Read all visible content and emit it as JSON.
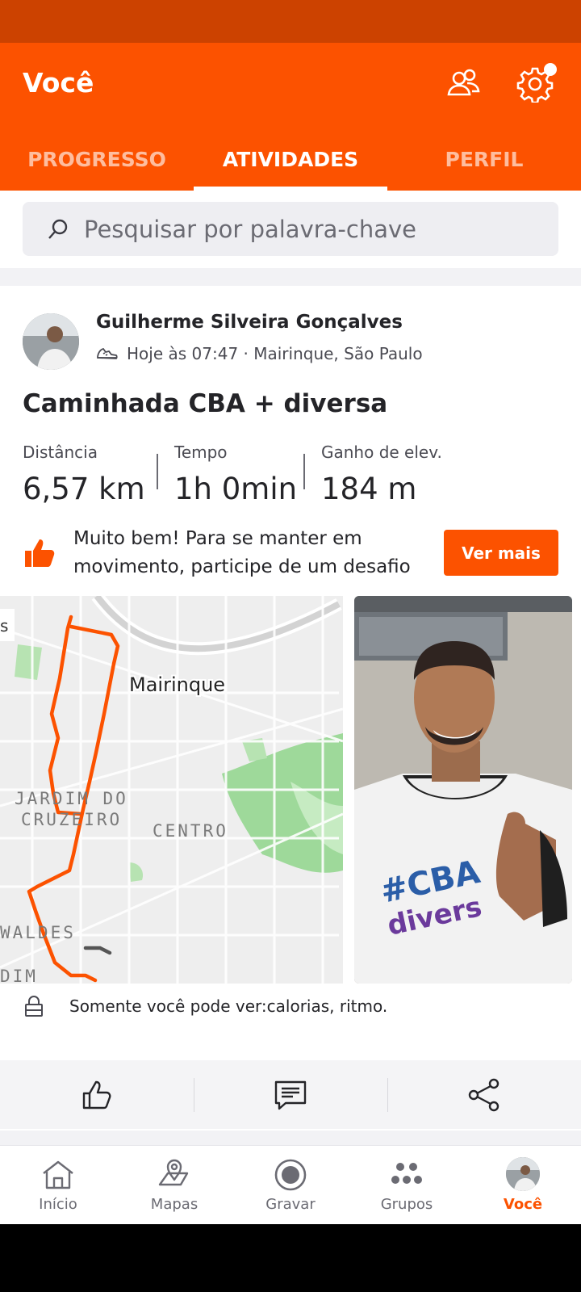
{
  "header": {
    "title": "Você",
    "tabs": [
      {
        "label": "PROGRESSO",
        "active": false
      },
      {
        "label": "ATIVIDADES",
        "active": true
      },
      {
        "label": "PERFIL",
        "active": false
      }
    ],
    "icons": [
      "friends-icon",
      "settings-icon"
    ]
  },
  "search": {
    "placeholder": "Pesquisar por palavra-chave"
  },
  "activity": {
    "athlete": "Guilherme Silveira Gonçalves",
    "meta": "Hoje às 07:47 · Mairinque, São Paulo",
    "title": "Caminhada CBA + diversa",
    "stats": [
      {
        "label": "Distância",
        "value": "6,57 km"
      },
      {
        "label": "Tempo",
        "value": "1h 0min"
      },
      {
        "label": "Ganho de elev.",
        "value": "184 m"
      }
    ],
    "challenge_message": "Muito bem! Para se manter em movimento, participe de um desafio",
    "challenge_button": "Ver mais",
    "map_labels": {
      "city": "Mairinque",
      "jardim_line1": "JARDIM DO",
      "jardim_line2": "CRUZEIRO",
      "centro": "CENTRO",
      "waldes": "WALDES",
      "edge_s": "s",
      "edge_dim": "DIM"
    },
    "privacy_note": "Somente você pode ver:calorias, ritmo."
  },
  "bottom_nav": [
    {
      "label": "Início",
      "icon": "home-icon"
    },
    {
      "label": "Mapas",
      "icon": "map-icon"
    },
    {
      "label": "Gravar",
      "icon": "record-icon"
    },
    {
      "label": "Grupos",
      "icon": "groups-icon"
    },
    {
      "label": "Você",
      "icon": "avatar",
      "active": true
    }
  ],
  "colors": {
    "brand": "#FC5200",
    "status_bar": "#CC4200",
    "route": "#FC5200"
  }
}
